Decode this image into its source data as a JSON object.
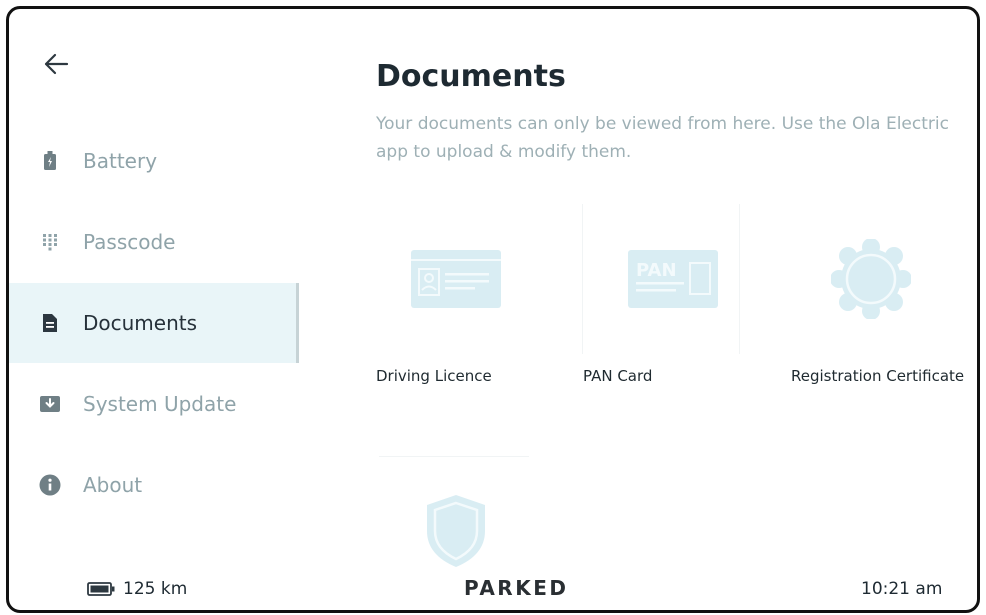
{
  "sidebar": {
    "back_icon": "arrow-left-icon",
    "items": [
      {
        "label": "Battery",
        "icon": "battery-icon",
        "active": false
      },
      {
        "label": "Passcode",
        "icon": "keypad-icon",
        "active": false
      },
      {
        "label": "Documents",
        "icon": "document-icon",
        "active": true
      },
      {
        "label": "System Update",
        "icon": "download-icon",
        "active": false
      },
      {
        "label": "About",
        "icon": "info-icon",
        "active": false
      }
    ]
  },
  "main": {
    "title": "Documents",
    "subtitle": "Your documents can only be viewed from here. Use the Ola Electric app to upload & modify them.",
    "documents": [
      {
        "label": "Driving Licence",
        "icon": "id-card-icon"
      },
      {
        "label": "PAN Card",
        "icon": "pan-card-icon",
        "icon_text": "PAN"
      },
      {
        "label": "Registration Certificate",
        "icon": "certificate-seal-icon"
      },
      {
        "label": "",
        "icon": "shield-icon"
      }
    ]
  },
  "footer": {
    "range": "125 km",
    "status": "PARKED",
    "time": "10:21 am"
  },
  "colors": {
    "accent_light": "#e9f5f8",
    "icon_light": "#d9edf3",
    "muted_text": "#8fa3a9",
    "dark_text": "#1e2a32"
  }
}
